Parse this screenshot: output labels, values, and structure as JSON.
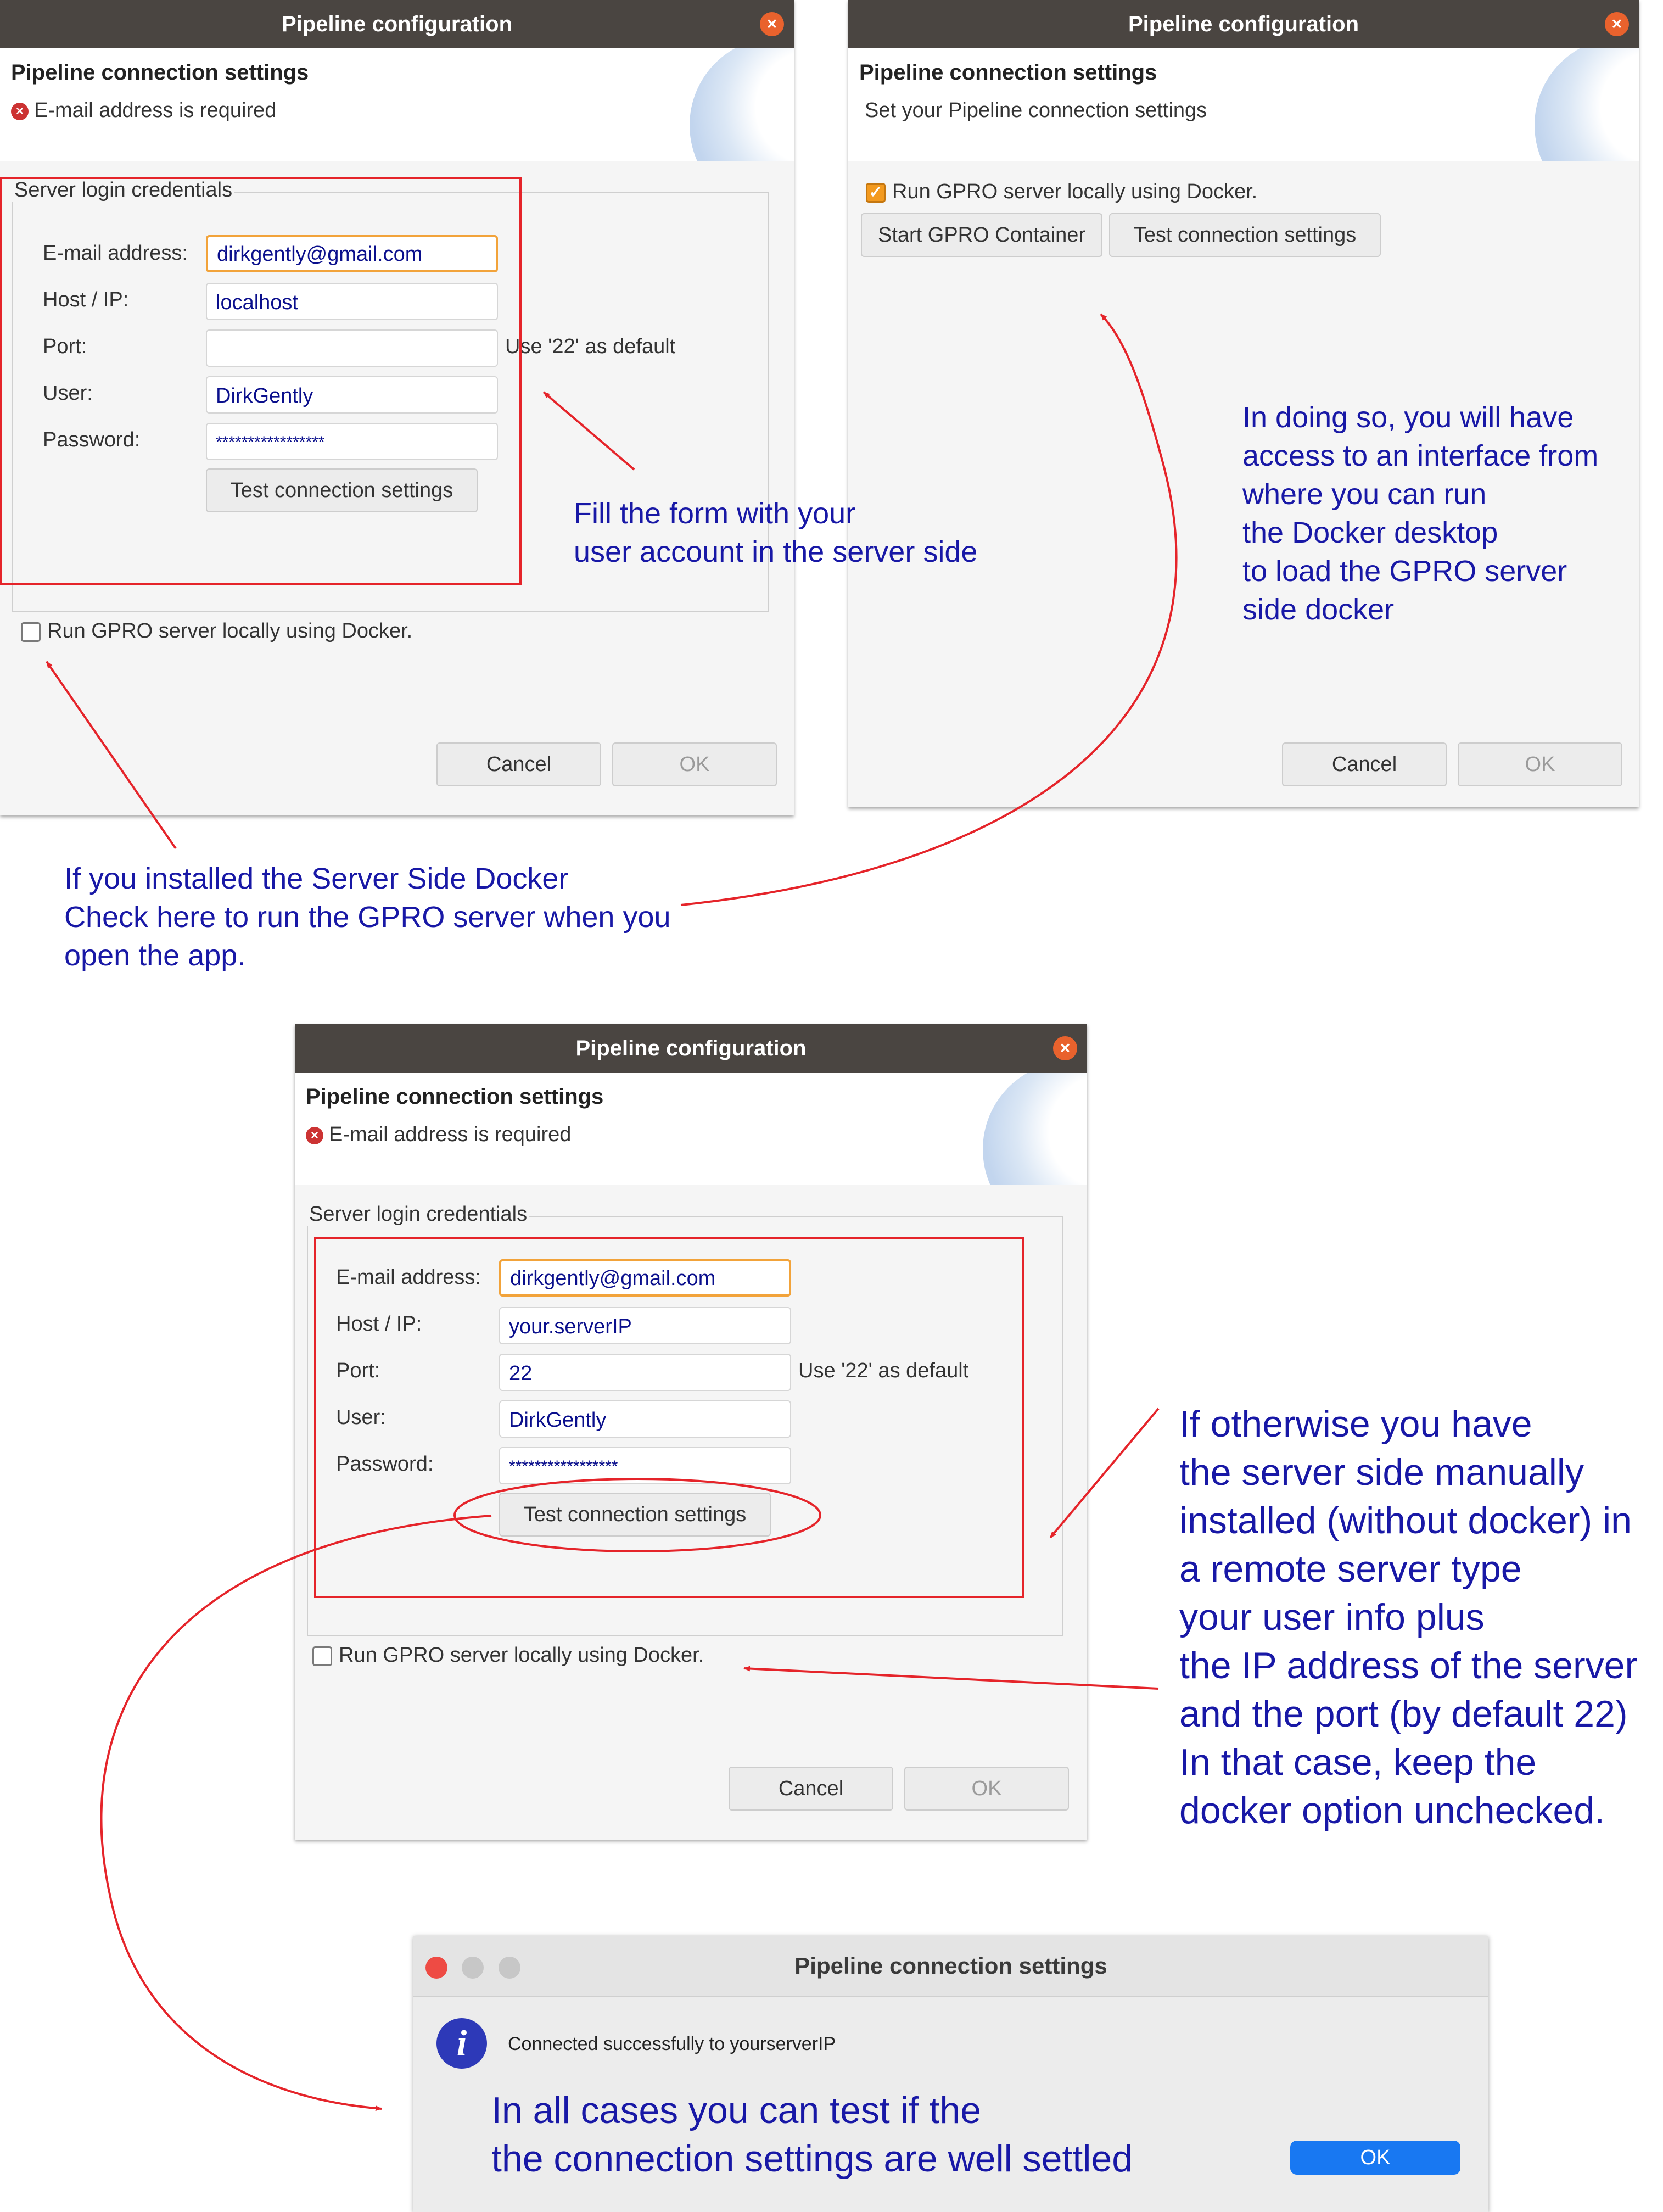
{
  "dialog_top_left": {
    "title": "Pipeline configuration",
    "header_title": "Pipeline connection settings",
    "header_message": "E-mail address is required",
    "group_label": "Server login credentials",
    "labels": {
      "email": "E-mail address:",
      "host": "Host / IP:",
      "port": "Port:",
      "user": "User:",
      "password": "Password:"
    },
    "values": {
      "email": "dirkgently@gmail.com",
      "host": "localhost",
      "port": "",
      "user": "DirkGently",
      "password": "*****************"
    },
    "port_hint": "Use '22' as default",
    "test_button": "Test connection settings",
    "docker_checkbox": "Run GPRO server locally using Docker.",
    "docker_checked": false,
    "cancel": "Cancel",
    "ok": "OK"
  },
  "dialog_top_right": {
    "title": "Pipeline configuration",
    "header_title": "Pipeline connection settings",
    "header_message": "Set your Pipeline connection settings",
    "docker_checkbox": "Run GPRO server locally using Docker.",
    "docker_checked": true,
    "start_button": "Start GPRO Container",
    "test_button": "Test connection settings",
    "cancel": "Cancel",
    "ok": "OK"
  },
  "dialog_middle": {
    "title": "Pipeline configuration",
    "header_title": "Pipeline connection settings",
    "header_message": "E-mail address is required",
    "group_label": "Server login credentials",
    "labels": {
      "email": "E-mail address:",
      "host": "Host / IP:",
      "port": "Port:",
      "user": "User:",
      "password": "Password:"
    },
    "values": {
      "email": "dirkgently@gmail.com",
      "host": "your.serverIP",
      "port": "22",
      "user": "DirkGently",
      "password": "*****************"
    },
    "port_hint": "Use '22' as default",
    "test_button": "Test connection settings",
    "docker_checkbox": "Run GPRO server locally using Docker.",
    "docker_checked": false,
    "cancel": "Cancel",
    "ok": "OK"
  },
  "mac_dialog": {
    "title": "Pipeline connection settings",
    "message": "Connected successfully to yourserverIP",
    "ok": "OK"
  },
  "annotations": {
    "fill_form": "Fill the form with your\nuser account in the server side",
    "docker_desktop": "In doing so, you will have\naccess to an interface from\nwhere you can run\nthe Docker desktop\nto load the GPRO server\nside docker",
    "server_side_docker": "If you installed the Server Side Docker\nCheck here to run the GPRO server when you\nopen the app.",
    "otherwise": "If otherwise you have\nthe server side manually\ninstalled (without docker) in\na remote server type\nyour user info plus\nthe IP address of the server\nand the port (by default 22)\nIn that case, keep the\ndocker option unchecked.",
    "all_cases": "In all cases you can test if the\nthe connection settings are well settled"
  },
  "icons": {
    "close": "close-icon",
    "error": "error-icon",
    "info": "info-icon",
    "checkmark": "checkmark-icon"
  },
  "colors": {
    "titlebar": "#4a4541",
    "close_button": "#e9622d",
    "annotation_text": "#1818a6",
    "annotation_lines": "#e5242a",
    "focus_border": "#f2a33a",
    "mac_ok": "#1878f2"
  }
}
